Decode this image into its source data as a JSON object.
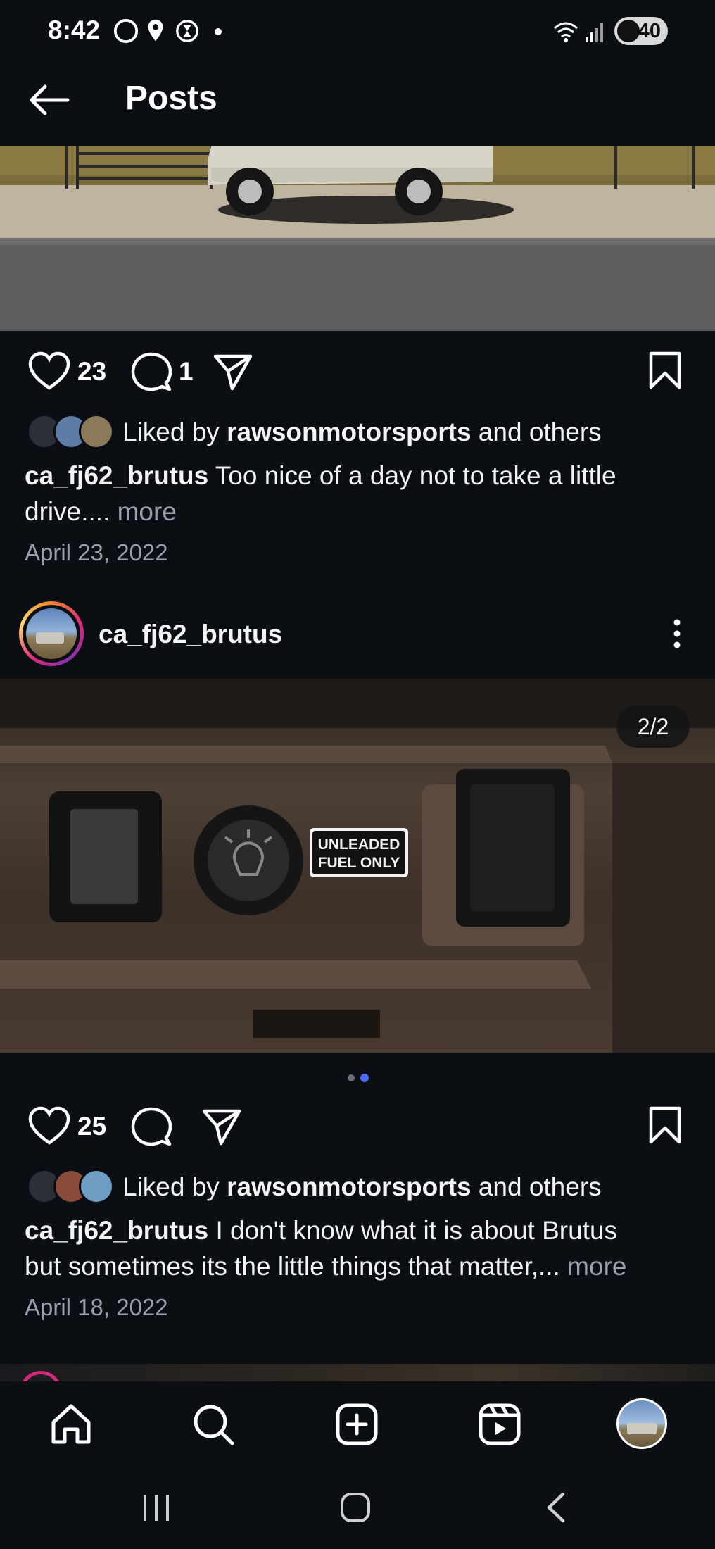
{
  "status_bar": {
    "time": "8:42",
    "battery": "40",
    "icons": [
      "moon-icon",
      "location-icon",
      "hourglass-icon",
      "dot-icon",
      "wifi-icon",
      "signal-icon",
      "battery-icon"
    ]
  },
  "header": {
    "title": "Posts",
    "back_icon": "back-arrow-icon"
  },
  "post1": {
    "likes": "23",
    "comments": "1",
    "liked_by_prefix": "Liked by ",
    "liked_by_user": "rawsonmotorsports",
    "liked_by_suffix": " and others",
    "username": "ca_fj62_brutus",
    "caption_line1": " Too nice of a day not to take a little",
    "caption_line2": "drive....",
    "more": " more",
    "date": "April 23, 2022"
  },
  "post2": {
    "username": "ca_fj62_brutus",
    "image_counter": "2/2",
    "image_text_line1": "UNLEADED",
    "image_text_line2": "FUEL ONLY",
    "likes": "25",
    "liked_by_prefix": "Liked by ",
    "liked_by_user": "rawsonmotorsports",
    "liked_by_suffix": " and others",
    "caption_line1": " I don't know what it is about Brutus",
    "caption_line2": "but sometimes its the little things that matter,...",
    "more": " more",
    "date": "April 18, 2022",
    "carousel_index": 2,
    "carousel_total": 2
  },
  "colors": {
    "background": "#0b0f14",
    "accent_dot": "#4a6cf7",
    "muted": "#9aa0a6"
  },
  "bottom_nav": [
    "home-icon",
    "search-icon",
    "create-icon",
    "reels-icon",
    "profile-avatar"
  ],
  "system_nav": [
    "recents-icon",
    "home-button-icon",
    "back-icon"
  ]
}
